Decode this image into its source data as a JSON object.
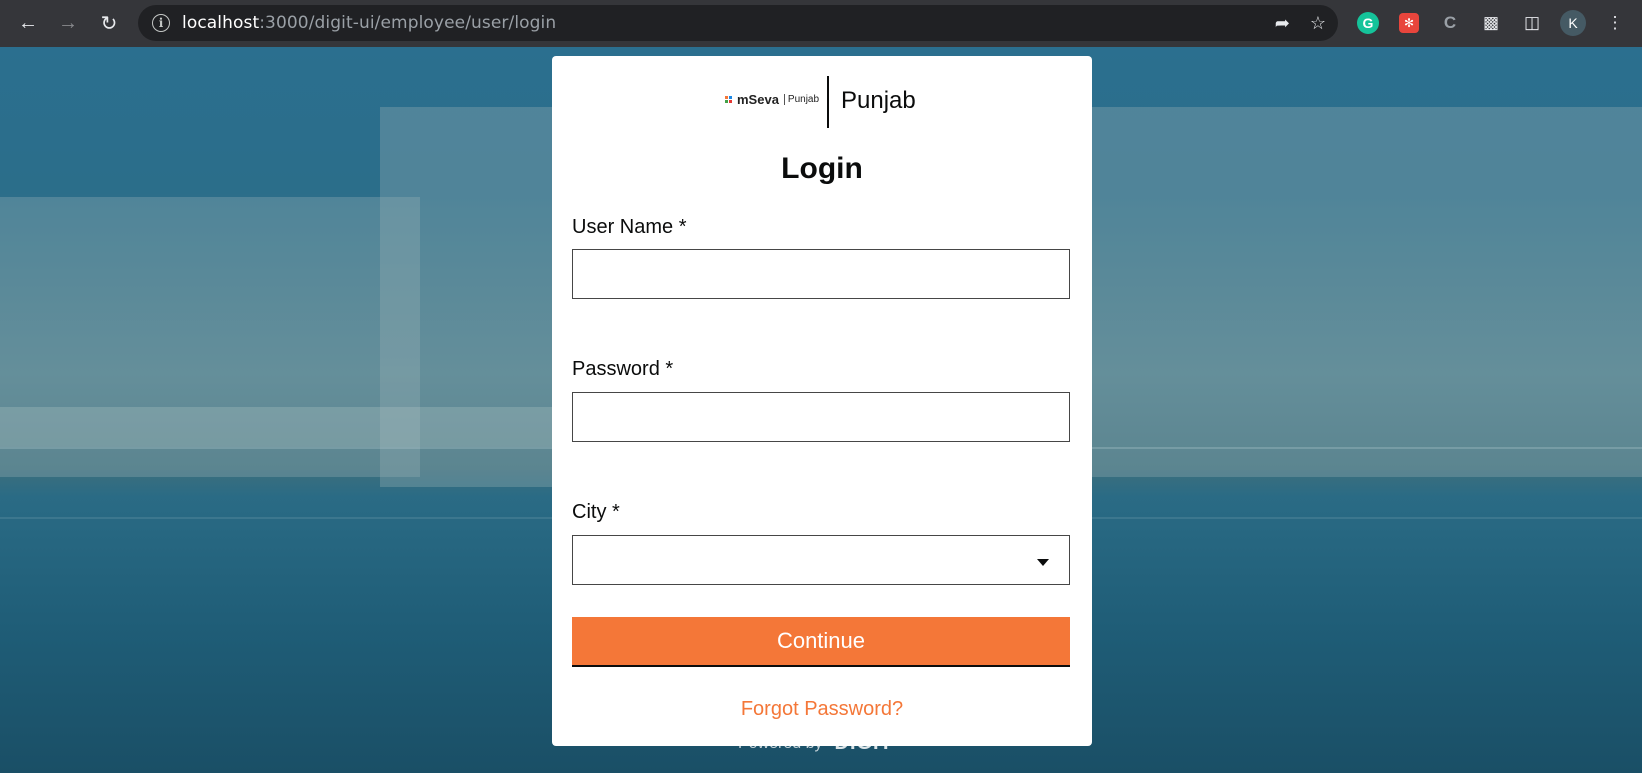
{
  "browser": {
    "url_host": "localhost",
    "url_path": ":3000/digit-ui/employee/user/login",
    "profile_initial": "K",
    "grammarly_letter": "G",
    "ext_c_label": "C"
  },
  "brand": {
    "logo_text": "mSeva",
    "logo_sub": "Punjab",
    "state_name": "Punjab",
    "logo_dot_colors": [
      "#f47738",
      "#1e88e5",
      "#43a047",
      "#e53935"
    ]
  },
  "form": {
    "title": "Login",
    "username_label": "User Name *",
    "username_value": "",
    "password_label": "Password *",
    "password_value": "",
    "city_label": "City *",
    "city_value": "",
    "continue_label": "Continue",
    "forgot_label": "Forgot Password?"
  },
  "footer": {
    "powered_by": "Powered by",
    "digit_logo": "DIGIT"
  },
  "colors": {
    "accent": "#f47738",
    "text": "#0b0c0c",
    "background_tint": "#1f5a73"
  }
}
